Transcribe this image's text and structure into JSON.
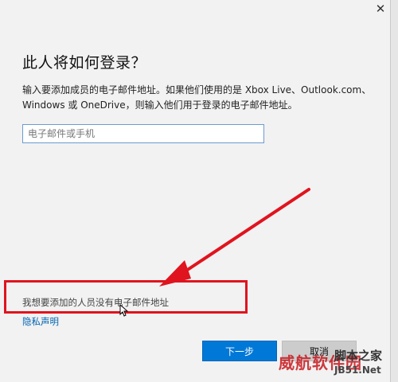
{
  "dialog": {
    "close_glyph": "✕",
    "heading": "此人将如何登录？",
    "description": "输入要添加成员的电子邮件地址。如果他们使用的是 Xbox Live、Outlook.com、Windows 或 OneDrive，则输入他们用于登录的电子邮件地址。",
    "email_input": {
      "value": "",
      "placeholder": "电子邮件或手机"
    },
    "no_email_link": "我想要添加的人员没有电子邮件地址",
    "privacy_link": "隐私声明",
    "next_button": "下一步",
    "cancel_button": "取消"
  },
  "annotation": {
    "highlight_color": "#e0141e",
    "arrow_color": "#e0141e"
  },
  "watermark": {
    "line_a": "脚本之家",
    "line_b": "威航软件园",
    "line_c": "JB51.Net"
  },
  "colors": {
    "accent": "#0078d7",
    "link": "#0063b1",
    "dialog_bg": "#f2f2f2"
  }
}
